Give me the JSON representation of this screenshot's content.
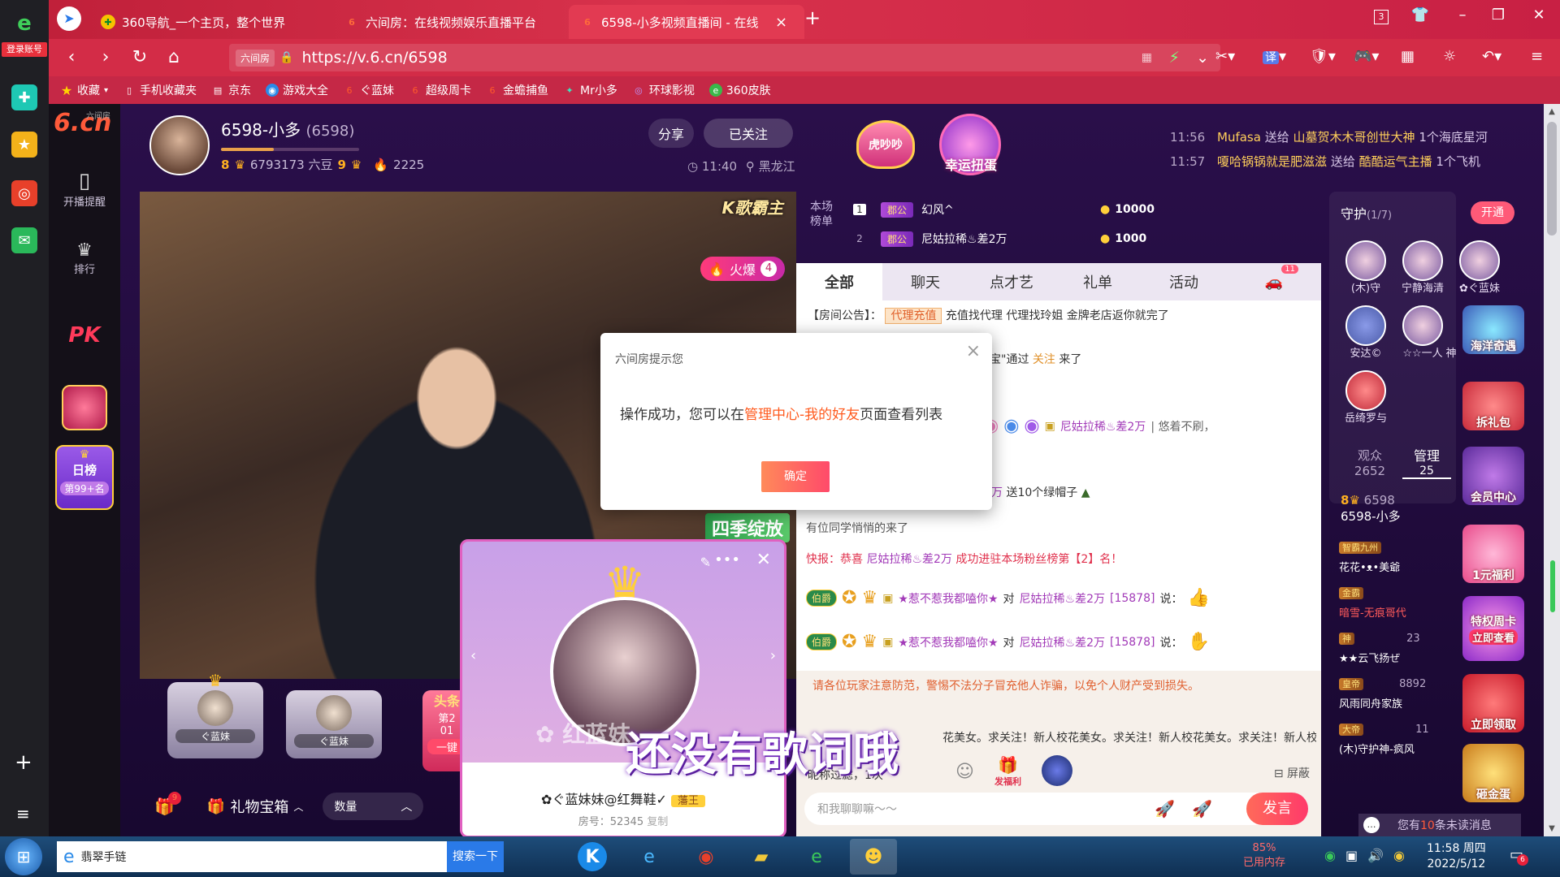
{
  "browser": {
    "sidebar_login": "登录账号",
    "tabs": [
      {
        "title": "360导航_一个主页，整个世界"
      },
      {
        "title": "六间房：在线视频娱乐直播平台"
      },
      {
        "title": "6598-小多视频直播间 - 在线"
      }
    ],
    "tab_counter": "3",
    "url": "https://v.6.cn/6598",
    "url_badge": "六间房",
    "translate_label": "译",
    "bookmarks": [
      "收藏",
      "手机收藏夹",
      "京东",
      "游戏大全",
      "ぐ蓝妹",
      "超级周卡",
      "金蟾捕鱼",
      "Mr小多",
      "环球影视",
      "360皮肤"
    ]
  },
  "site": {
    "logo": "6.cn",
    "logo_sub": "六间房",
    "nav": [
      {
        "label": "开播提醒",
        "icon": "phone-icon"
      },
      {
        "label": "排行",
        "icon": "crown-icon"
      }
    ],
    "pk_label": "PK",
    "daily_rank_title": "日榜",
    "daily_rank_value": "第99+名"
  },
  "streamer": {
    "name": "6598-小多",
    "room": "(6598)",
    "level_left": "8",
    "beans": "6793173 六豆",
    "level_right": "9",
    "fans": "2225",
    "share_label": "分享",
    "follow_label": "已关注",
    "time": "11:40",
    "location": "黑龙江"
  },
  "top_banner": {
    "badge1": "虎吵吵",
    "badge2": "幸运扭蛋",
    "ticker": [
      {
        "time": "11:56",
        "text_a": "Mufasa",
        "verb": "送给",
        "text_b": "山墓贺木木哥创世大神",
        "gift": "1个海底星河"
      },
      {
        "time": "11:57",
        "text_a": "嗄哈锅锅就是肥滋滋",
        "verb": "送给",
        "text_b": "酷酷运气主播",
        "gift": "1个飞机"
      }
    ]
  },
  "video": {
    "top_right_tag": "K歌霸主",
    "hot_label": "火爆",
    "hot_count": "4",
    "season_tag": "四季绽放",
    "lyrics": "还没有歌词哦",
    "seats": [
      {
        "name": "ぐ蓝妹"
      },
      {
        "name": "ぐ蓝妹"
      }
    ],
    "side_rank_tag": "第2",
    "side_rank_num": "01",
    "side_btn": "一键",
    "side_title": "头条"
  },
  "bottom_bar": {
    "badge_count": "9",
    "gift_box_label": "礼物宝箱",
    "quantity_label": "数量"
  },
  "rank_panel": {
    "title": "本场榜单",
    "rows": [
      {
        "rank": "1",
        "title": "郡公",
        "name": "幻风^",
        "coins": "10000"
      },
      {
        "rank": "2",
        "title": "郡公",
        "name": "尼姑拉稀♨差2万",
        "coins": "1000"
      }
    ]
  },
  "chat": {
    "tabs": [
      "全部",
      "聊天",
      "点才艺",
      "礼单",
      "活动"
    ],
    "car_count": "11",
    "notice_label": "【房间公告】：",
    "notice_tag": "代理充值",
    "notice_text": "充值找代理 代理找玲姐 金牌老店返你就完了",
    "join_text": "宝\"通过",
    "join_link": "关注",
    "join_suffix": "来了",
    "msg_name": "尼姑拉稀♨差2万",
    "msg_comment": "| 悠着不刷，",
    "gift_line_a": "万",
    "gift_line_b": "送10个绿帽子",
    "classmate": "有位同学悄悄的来了",
    "flash": "快报：恭喜",
    "flash_name": "尼姑拉稀♨差2万",
    "flash_suffix": "成功进驻本场粉丝榜第【2】名！",
    "msgs": [
      {
        "badge": "伯爵",
        "name": "★惹不惹我都嗑你★",
        "verb": "对",
        "target": "尼姑拉稀♨差2万",
        "id": "[15878]",
        "say": "说："
      },
      {
        "badge": "伯爵",
        "name": "★惹不惹我都嗑你★",
        "verb": "对",
        "target": "尼姑拉稀♨差2万",
        "id": "[15878]",
        "say": "说："
      }
    ],
    "warning": "请各位玩家注意防范，警惕不法分子冒充他人诈骗，以免个人财产受到损失。",
    "scroll_text": "花美女。求关注！新人校花美女。求关注！新人校花美女。求关注！新人校花美女。求关注！新",
    "filter_text": "昵称过滤，1次",
    "mute_label": "屏蔽",
    "welfare_label": "发福利",
    "input_placeholder": "和我聊聊嘛～～",
    "send_label": "发言"
  },
  "guard": {
    "title": "守护",
    "count": "(1/7)",
    "open_label": "开通",
    "members": [
      {
        "name": "(木)守"
      },
      {
        "name": "宁静海清"
      },
      {
        "name": "✿ぐ蓝妹"
      },
      {
        "name": "安达©"
      },
      {
        "name": "☆☆一人"
      },
      {
        "name": "神"
      },
      {
        "name": "岳绮罗与"
      }
    ],
    "audience_label": "观众",
    "audience_count": "2652",
    "manage_label": "管理",
    "manage_count": "25",
    "self_level": "8",
    "self_id": "6598",
    "self_name": "6598-小多",
    "list": [
      {
        "tag": "智霸九州",
        "name": "花花•ᴥ•美爺"
      },
      {
        "tag": "金霸",
        "name": "暗雪-无痕哥代"
      },
      {
        "tag": "神",
        "num": "23",
        "name": "★★云飞扬ぜ"
      },
      {
        "tag": "皇帝",
        "num": "8892",
        "name": "风雨同舟家族"
      },
      {
        "tag": "大帝",
        "num": "11",
        "name": "(木)守护神-疯风"
      }
    ],
    "unread_prefix": "您有",
    "unread_count": "10",
    "unread_suffix": "条未读消息"
  },
  "promos": [
    {
      "label": "海洋奇遇"
    },
    {
      "label": "拆礼包"
    },
    {
      "label": "会员中心"
    },
    {
      "label": "1元福利"
    },
    {
      "label": "特权周卡"
    },
    {
      "label": "立即查看"
    },
    {
      "label": "立即领取"
    },
    {
      "label": "砸金蛋"
    }
  ],
  "dialog": {
    "title": "六间房提示您",
    "msg_prefix": "操作成功，您可以在",
    "msg_link": "管理中心-我的好友",
    "msg_suffix": "页面查看列表",
    "ok_label": "确定"
  },
  "card": {
    "name": "✿ぐ蓝妹妹@红舞鞋✓",
    "badge": "藩王",
    "room_prefix": "房号：52345",
    "copy_label": "复制",
    "watermark": "✿ 红蓝妹"
  },
  "taskbar": {
    "search_text": "翡翠手链",
    "search_btn": "搜索一下",
    "mem_percent": "85%",
    "mem_label": "已用内存",
    "time": "11:58 周四",
    "date": "2022/5/12",
    "notif_count": "6"
  },
  "colors": {
    "browser_red": "#d32c47",
    "accent_pink": "#ff5a78",
    "link_orange": "#ff5a1e",
    "page_purple": "#2a0f4a"
  }
}
